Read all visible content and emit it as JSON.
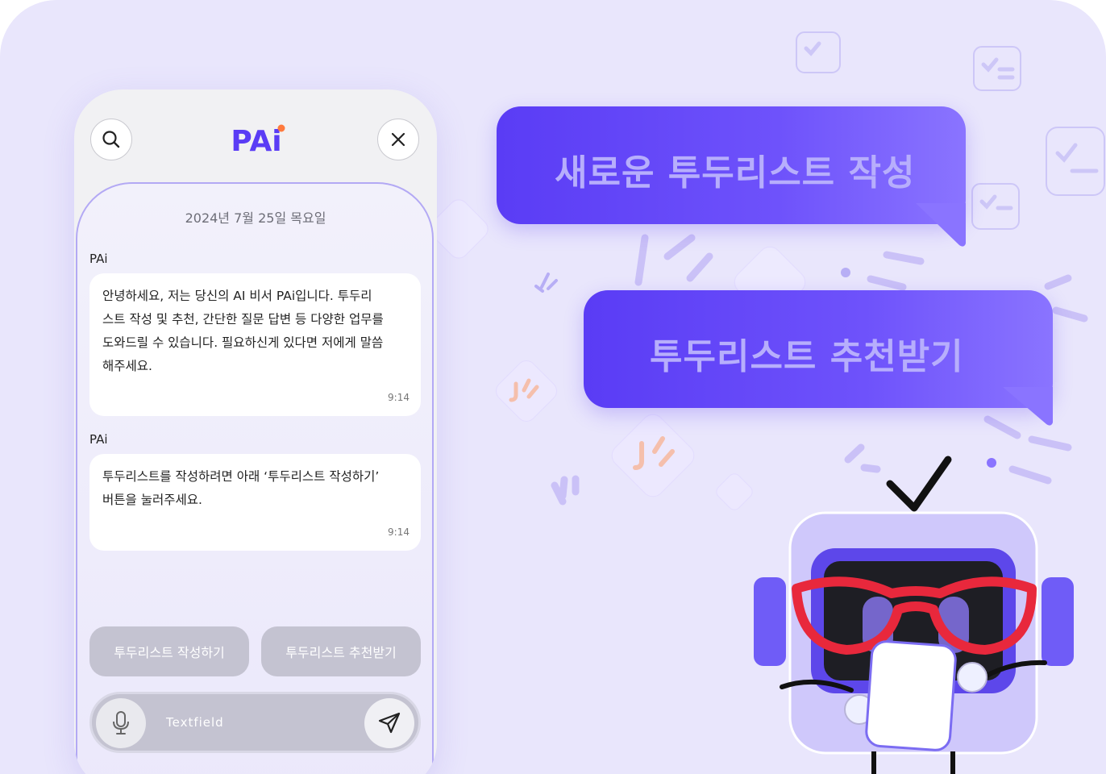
{
  "app": {
    "logo_text": "PAi"
  },
  "colors": {
    "background": "#e9e6fc",
    "accent": "#5a3cf5",
    "bubble_text": "#b7aefc",
    "button_disabled": "#c4c3d1"
  },
  "header": {
    "search_icon": "search-icon",
    "close_icon": "close-icon"
  },
  "chat": {
    "date": "2024년 7월 25일 목요일",
    "messages": [
      {
        "sender": "PAi",
        "text": "안녕하세요, 저는 당신의 AI 비서 PAi입니다. 투두리스트 작성 및 추천, 간단한 질문 답변 등 다양한 업무를 도와드릴 수 있습니다. 필요하신게 있다면 저에게 말씀해주세요.",
        "lines": [
          "안녕하세요, 저는 당신의 AI 비서 PAi입니다. 투두리",
          "스트 작성 및 추천, 간단한 질문 답변 등 다양한 업무를",
          "도와드릴 수 있습니다. 필요하신게 있다면 저에게 말씀",
          "해주세요."
        ],
        "time": "9:14"
      },
      {
        "sender": "PAi",
        "text": "투두리스트를 작성하려면 아래 ‘투두리스트 작성하기’ 버튼을 눌러주세요.",
        "lines": [
          "투두리스트를 작성하려면 아래 ‘투두리스트 작성하기’",
          "버튼을 눌러주세요."
        ],
        "time": "9:14"
      }
    ]
  },
  "actions": {
    "write_label": "투두리스트 작성하기",
    "recommend_label": "투두리스트 추천받기"
  },
  "input": {
    "placeholder": "Textfield",
    "mic_icon": "microphone-icon",
    "send_icon": "send-icon"
  },
  "promo": {
    "bubble_1": "새로운 투두리스트 작성",
    "bubble_2": "투두리스트 추천받기"
  }
}
